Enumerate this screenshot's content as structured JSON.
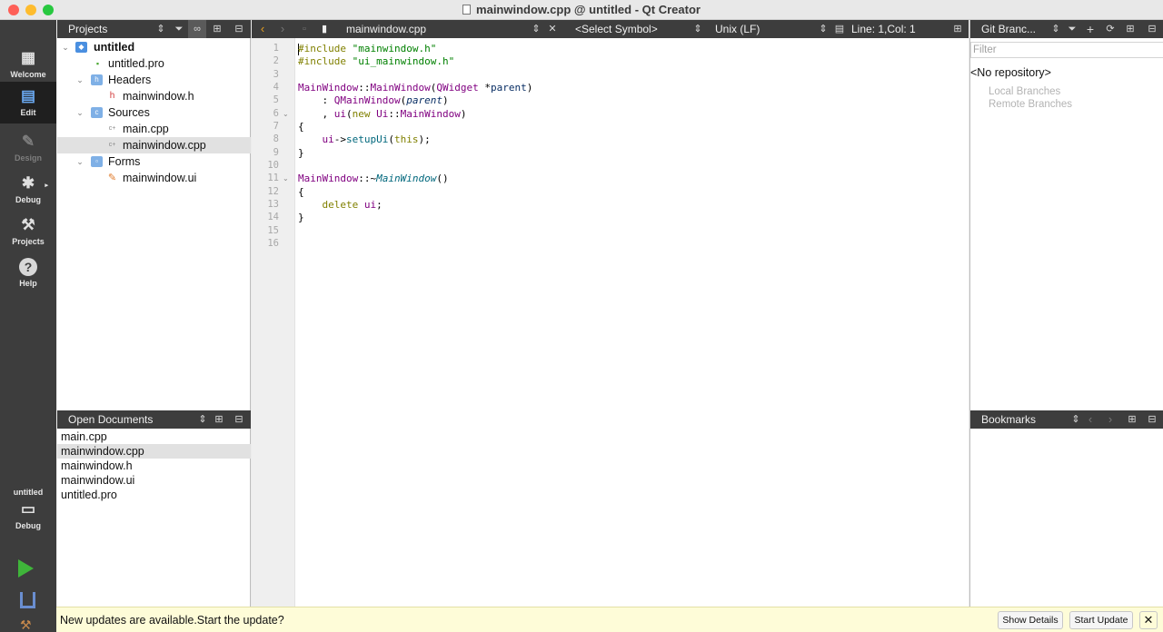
{
  "window": {
    "title": "mainwindow.cpp @ untitled - Qt Creator",
    "traffic_lights": {
      "close": "#fe5f57",
      "minimize": "#febc2e",
      "maximize": "#28c840"
    }
  },
  "modes": [
    {
      "label": "Welcome",
      "icon": "grid-icon",
      "glyph": "▦"
    },
    {
      "label": "Edit",
      "icon": "document-edit-icon",
      "glyph": "▤"
    },
    {
      "label": "Design",
      "icon": "pencil-icon",
      "glyph": "✎"
    },
    {
      "label": "Debug",
      "icon": "bug-icon",
      "glyph": "✱"
    },
    {
      "label": "Projects",
      "icon": "wrench-icon",
      "glyph": "⚒"
    },
    {
      "label": "Help",
      "icon": "help-icon",
      "glyph": "?"
    }
  ],
  "target": {
    "project": "untitled",
    "config": "Debug"
  },
  "projects_panel": {
    "title": "Projects",
    "tree": [
      {
        "label": "untitled",
        "icon": "project-icon",
        "bold": true
      },
      {
        "label": "untitled.pro",
        "icon": "pro-file-icon"
      },
      {
        "label": "Headers",
        "icon": "folder-icon"
      },
      {
        "label": "mainwindow.h",
        "icon": "header-file-icon"
      },
      {
        "label": "Sources",
        "icon": "folder-icon"
      },
      {
        "label": "main.cpp",
        "icon": "cpp-file-icon"
      },
      {
        "label": "mainwindow.cpp",
        "icon": "cpp-file-icon"
      },
      {
        "label": "Forms",
        "icon": "folder-icon"
      },
      {
        "label": "mainwindow.ui",
        "icon": "ui-file-icon"
      }
    ]
  },
  "open_documents": {
    "title": "Open Documents",
    "items": [
      "main.cpp",
      "mainwindow.cpp",
      "mainwindow.h",
      "mainwindow.ui",
      "untitled.pro"
    ],
    "selected": "mainwindow.cpp"
  },
  "editor_toolbar": {
    "file": "mainwindow.cpp",
    "symbol": "<Select Symbol>",
    "line_ending": "Unix (LF)",
    "position": "Line: 1,Col: 1"
  },
  "editor": {
    "line_numbers": [
      "1",
      "2",
      "3",
      "4",
      "5",
      "6",
      "7",
      "8",
      "9",
      "10",
      "11",
      "12",
      "13",
      "14",
      "15",
      "16"
    ]
  },
  "git_panel": {
    "title": "Git Branc...",
    "filter_placeholder": "Filter",
    "repo": "<No repository>",
    "local": "Local Branches",
    "remote": "Remote Branches"
  },
  "bookmarks_panel": {
    "title": "Bookmarks"
  },
  "notification": {
    "message": "New updates are available.Start the update?",
    "show_details": "Show Details",
    "start_update": "Start Update"
  }
}
